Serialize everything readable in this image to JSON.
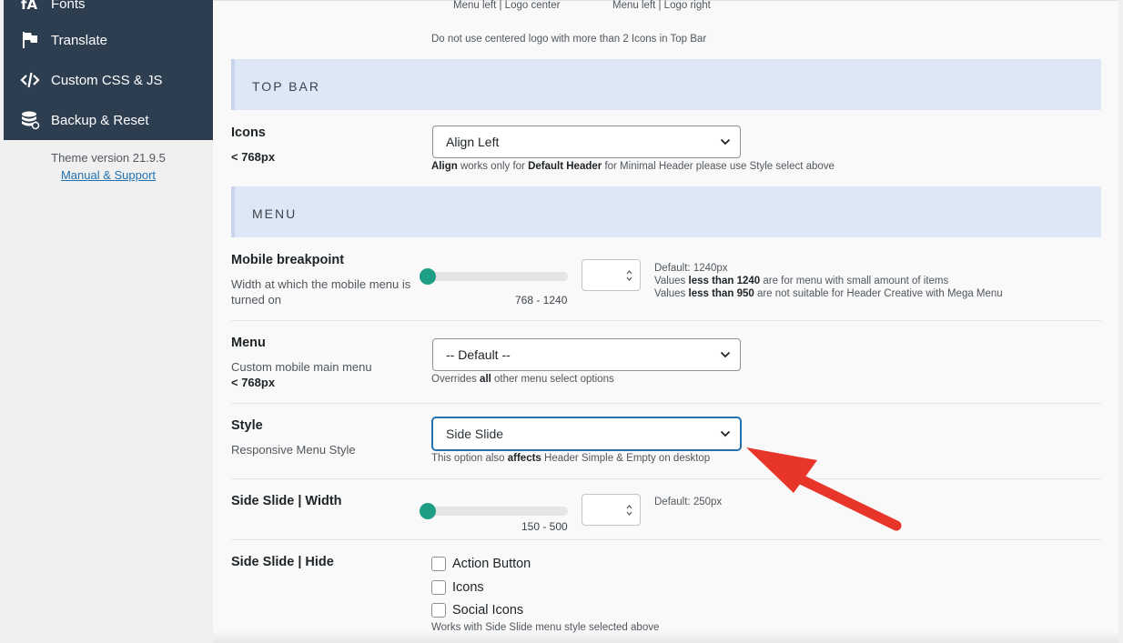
{
  "sidebar": {
    "items": [
      {
        "label": "Fonts",
        "icon": "font-icon"
      },
      {
        "label": "Translate",
        "icon": "flag-icon"
      },
      {
        "label": "Custom CSS & JS",
        "icon": "code-icon"
      },
      {
        "label": "Backup & Reset",
        "icon": "database-icon"
      }
    ],
    "theme_version": "Theme version 21.9.5",
    "manual_link": "Manual & Support"
  },
  "logo_options": {
    "menu_left_logo_center": "Menu left | Logo center",
    "menu_left_logo_right": "Menu left | Logo right",
    "note": "Do not use centered logo with more than 2 Icons in Top Bar"
  },
  "top_bar": {
    "heading": "TOP BAR",
    "icons": {
      "title": "Icons",
      "subtitle": "< 768px",
      "value": "Align Left",
      "help_bold1": "Align",
      "help_text1": " works only for ",
      "help_bold2": "Default Header",
      "help_text2": " for Minimal Header please use Style select above"
    }
  },
  "menu": {
    "heading": "MENU",
    "breakpoint": {
      "title": "Mobile breakpoint",
      "desc": "Width at which the mobile menu is turned on",
      "range": "768 - 1240",
      "input_value": "",
      "slider_value": 0,
      "help_default": "Default: 1240px",
      "help_line2_pre": "Values ",
      "help_line2_bold": "less than 1240",
      "help_line2_post": " are for menu with small amount of items",
      "help_line3_pre": "Values ",
      "help_line3_bold": "less than 950",
      "help_line3_post": " are not suitable for Header Creative with Mega Menu"
    },
    "menu_select": {
      "title": "Menu",
      "desc": "Custom mobile main menu",
      "desc_bold": "< 768px",
      "value": "-- Default --",
      "help_pre": "Overrides ",
      "help_bold": "all",
      "help_post": " other menu select options"
    },
    "style": {
      "title": "Style",
      "desc": "Responsive Menu Style",
      "value": "Side Slide",
      "help_pre": "This option also ",
      "help_bold": "affects",
      "help_post": " Header Simple & Empty on desktop"
    },
    "side_slide_width": {
      "title": "Side Slide | Width",
      "range": "150 - 500",
      "input_value": "",
      "slider_value": 0,
      "help": "Default: 250px"
    },
    "side_slide_hide": {
      "title": "Side Slide | Hide",
      "options": [
        {
          "label": "Action Button",
          "checked": false
        },
        {
          "label": "Icons",
          "checked": false
        },
        {
          "label": "Social Icons",
          "checked": false
        }
      ],
      "help": "Works with Side Slide menu style selected above"
    }
  },
  "colors": {
    "sidebar_bg": "#2d3e50",
    "section_bg": "#dde7f6",
    "slider_accent": "#1f9e86",
    "focus_blue": "#2271b1",
    "arrow_red": "#e8352a"
  }
}
